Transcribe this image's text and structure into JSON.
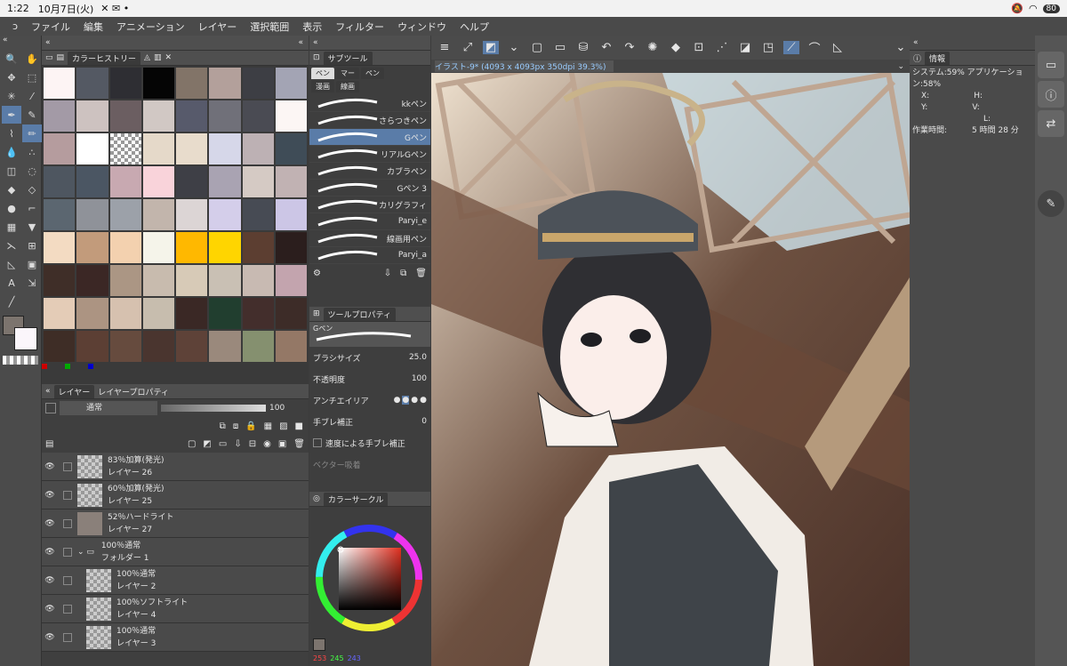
{
  "status": {
    "time": "1:22",
    "date": "10月7日(火)",
    "battery": "80"
  },
  "menu": [
    "ファイル",
    "編集",
    "アニメーション",
    "レイヤー",
    "選択範囲",
    "表示",
    "フィルター",
    "ウィンドウ",
    "ヘルプ"
  ],
  "color_history": {
    "title": "カラーヒストリー",
    "swatches": [
      "#fdf4f4",
      "#545963",
      "#2e2e33",
      "#050505",
      "#827468",
      "#b3a09b",
      "#3d3e44",
      "#a3a4b4",
      "#a39aa6",
      "#cdc2c0",
      "#6b5e61",
      "#d1c8c4",
      "#575a6b",
      "#707079",
      "#4a4b53",
      "#fcf6f4",
      "#b59c9e",
      "#ffffff",
      "#cccccc",
      "#e5d9c9",
      "#e8dccc",
      "#d6d7e9",
      "#bdb1b4",
      "#3f4c57",
      "#4e5660",
      "#4b5663",
      "#c8a9b1",
      "#f9d3da",
      "#3e3f46",
      "#a9a3b2",
      "#d5cac4",
      "#c1b2b3",
      "#5b6670",
      "#8f9299",
      "#9ca1a9",
      "#c2b5ac",
      "#dcd5d5",
      "#d4ceea",
      "#474b54",
      "#ccc6e6",
      "#f3dbc2",
      "#c29b7b",
      "#f3d1af",
      "#f5f4ea",
      "#ffb800",
      "#ffd500",
      "#5c3e31",
      "#2b1e1d",
      "#3f2e28",
      "#3b2725",
      "#ab9684",
      "#c8bbae",
      "#d7cab7",
      "#c9c0b4",
      "#c8bab2",
      "#c3a4ae",
      "#e4ccb7",
      "#ac9482",
      "#d6c1af",
      "#c7bdae",
      "#3a2825",
      "#213e2f",
      "#432e2c",
      "#3d2c28",
      "#3e2d26",
      "#5c3f34",
      "#664b3e",
      "#4a352f",
      "#5e4238",
      "#9a897c",
      "#85906f",
      "#947866"
    ]
  },
  "layer_panel": {
    "tab_layer": "レイヤー",
    "tab_layer_prop": "レイヤープロパティ",
    "blend": "通常",
    "opacity": "100",
    "layers": [
      {
        "mode": "83％加算(発光)",
        "name": "レイヤー 26",
        "solid": false
      },
      {
        "mode": "60％加算(発光)",
        "name": "レイヤー 25",
        "solid": false
      },
      {
        "mode": "52％ハードライト",
        "name": "レイヤー 27",
        "solid": true
      },
      {
        "mode": "100％通常",
        "name": "フォルダー 1",
        "folder": true
      },
      {
        "mode": "100％通常",
        "name": "レイヤー 2",
        "solid": false
      },
      {
        "mode": "100％ソフトライト",
        "name": "レイヤー 4",
        "solid": false
      },
      {
        "mode": "100％通常",
        "name": "レイヤー 3",
        "solid": false
      }
    ]
  },
  "subtool": {
    "title": "サブツール",
    "tabs": [
      "ペン",
      "マー",
      "ペン"
    ],
    "tabs2": [
      "漫画",
      "線画"
    ],
    "brushes": [
      "kkペン",
      "さらつきペン",
      "Gペン",
      "リアルGペン",
      "カブラペン",
      "Gペン 3",
      "カリグラフィ",
      "Paryi_e",
      "線画用ペン",
      "Paryi_a"
    ],
    "selected_brush": "Gペン"
  },
  "tool_property": {
    "title": "ツールプロパティ",
    "brush_name": "Gペン",
    "brush_size_label": "ブラシサイズ",
    "brush_size": "25.0",
    "opacity_label": "不透明度",
    "opacity": "100",
    "antialias_label": "アンチエイリア",
    "stabilize_label": "手ブレ補正",
    "stabilize": "0",
    "speed_stabilize": "速度による手ブレ補正",
    "vector_label": "ベクター吸着"
  },
  "color_circle": {
    "title": "カラーサークル",
    "r": "253",
    "g": "245",
    "b": "243"
  },
  "canvas": {
    "tab": "イラスト-9* (4093 x 4093px 350dpi 39.3%)"
  },
  "info": {
    "title": "情報",
    "system": "システム:59% アプリケーション:58%",
    "x": "X:",
    "y": "Y:",
    "h": "H:",
    "v": "V:",
    "l": "L:",
    "work_time_label": "作業時間:",
    "work_time": "5 時間 28 分"
  }
}
